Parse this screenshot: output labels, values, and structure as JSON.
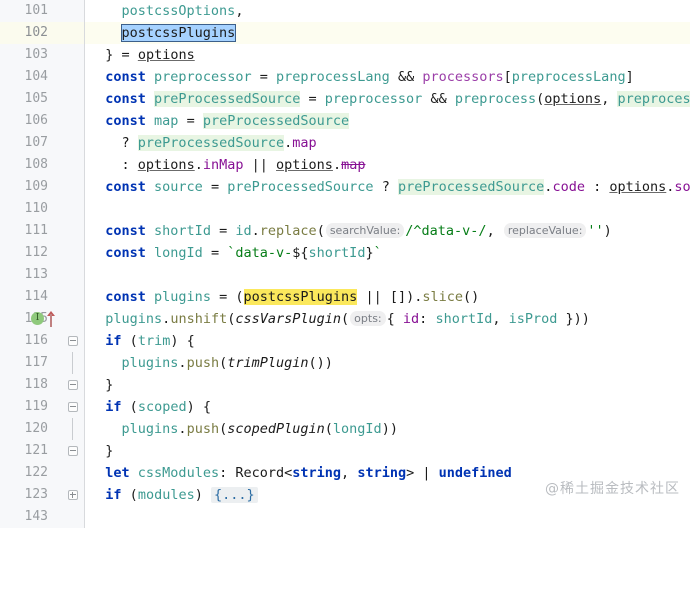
{
  "editor": {
    "language": "TypeScript",
    "first_visible_line": 101,
    "caret_line": 102,
    "selection_text": "postcssPlugins",
    "search_match_text": "postcssPlugins",
    "watermark": "@稀土掘金技术社区",
    "colors": {
      "background": "#ffffff",
      "gutter_background": "#f7f8fa",
      "line_number": "#999da1",
      "caret_row": "#fdfdf0",
      "keyword": "#0033b3",
      "identifier": "#3d9a91",
      "property": "#871094",
      "string": "#067d17",
      "function": "#7a7c43",
      "module_const": "#9b3ea8",
      "selection": "#a6d2ff",
      "search_highlight": "#fbe85c",
      "usage_highlight": "#e8f5e3",
      "inlay_hint_background": "#efeff0",
      "inlay_hint_text": "#7a7e85",
      "fold_placeholder_background": "#eceff1"
    }
  },
  "lines": [
    {
      "num": "101",
      "text": "    postcssOptions,"
    },
    {
      "num": "102",
      "text": "    postcssPlugins"
    },
    {
      "num": "103",
      "text": "  } = options"
    },
    {
      "num": "104",
      "text": "  const preprocessor = preprocessLang && processors[preprocessLang]"
    },
    {
      "num": "105",
      "text": "  const preProcessedSource = preprocessor && preprocess(options, preprocessor)"
    },
    {
      "num": "106",
      "text": "  const map = preProcessedSource"
    },
    {
      "num": "107",
      "text": "    ? preProcessedSource.map"
    },
    {
      "num": "108",
      "text": "    : options.inMap || options.map"
    },
    {
      "num": "109",
      "text": "  const source = preProcessedSource ? preProcessedSource.code : options.source"
    },
    {
      "num": "110",
      "text": ""
    },
    {
      "num": "111",
      "text": "  const shortId = id.replace( searchValue: /^data-v-/,  replaceValue: '')"
    },
    {
      "num": "112",
      "text": "  const longId = `data-v-${shortId}`"
    },
    {
      "num": "113",
      "text": ""
    },
    {
      "num": "114",
      "text": "  const plugins = (postcssPlugins || []).slice()"
    },
    {
      "num": "115",
      "text": "  plugins.unshift(cssVarsPlugin( opts: { id: shortId, isProd }))"
    },
    {
      "num": "116",
      "text": "  if (trim) {"
    },
    {
      "num": "117",
      "text": "    plugins.push(trimPlugin())"
    },
    {
      "num": "118",
      "text": "  }"
    },
    {
      "num": "119",
      "text": "  if (scoped) {"
    },
    {
      "num": "120",
      "text": "    plugins.push(scopedPlugin(longId))"
    },
    {
      "num": "121",
      "text": "  }"
    },
    {
      "num": "122",
      "text": "  let cssModules: Record<string, string> | undefined"
    },
    {
      "num": "123",
      "text": "  if (modules) {...}"
    },
    {
      "num": "143",
      "text": ""
    }
  ],
  "inlay_hints": [
    {
      "line": "111",
      "labels": [
        "searchValue:",
        "replaceValue:"
      ]
    },
    {
      "line": "115",
      "labels": [
        "opts:"
      ]
    }
  ],
  "gutter_icons": {
    "line_115": {
      "implementation_marker": "I",
      "arrow": "up-arrow-icon"
    }
  },
  "fold_markers": [
    {
      "line": "116",
      "state": "expanded"
    },
    {
      "line": "118",
      "state": "expanded-end"
    },
    {
      "line": "119",
      "state": "expanded"
    },
    {
      "line": "121",
      "state": "expanded-end"
    },
    {
      "line": "123",
      "state": "collapsed",
      "placeholder": "{...}"
    }
  ],
  "tokens": {
    "l101": {
      "a": "postcssOptions",
      "b": ","
    },
    "l102": {
      "a": "postcssPlugins"
    },
    "l103": {
      "a": "}",
      "b": "=",
      "c": "options"
    },
    "l104": {
      "kw": "const",
      "name": "preprocessor",
      "eq": "=",
      "r1": "preprocessLang",
      "op": "&&",
      "r2": "processors",
      "lb": "[",
      "r3": "preprocessLang",
      "rb": "]"
    },
    "l105": {
      "kw": "const",
      "name": "preProcessedSource",
      "eq": "=",
      "r1": "preprocessor",
      "op": "&&",
      "fn": "preprocess",
      "lp": "(",
      "a1": "options",
      "comma": ",",
      "a2": "preprocessor",
      "rp": ")"
    },
    "l106": {
      "kw": "const",
      "name": "map",
      "eq": "=",
      "r1": "preProcessedSource"
    },
    "l107": {
      "q": "?",
      "obj": "preProcessedSource",
      "dot": ".",
      "prop": "map"
    },
    "l108": {
      "c": ":",
      "obj1": "options",
      "p1": "inMap",
      "or": "||",
      "obj2": "options",
      "p2": "map"
    },
    "l109": {
      "kw": "const",
      "name": "source",
      "eq": "=",
      "cond": "preProcessedSource",
      "q": "?",
      "obj": "preProcessedSource",
      "prop": "code",
      "c": ":",
      "obj2": "options",
      "prop2": "source"
    },
    "l111": {
      "kw": "const",
      "name": "shortId",
      "eq": "=",
      "obj": "id",
      "fn": "replace",
      "hint1": "searchValue:",
      "regex": "/^data-v-/",
      "comma": ",",
      "hint2": "replaceValue:",
      "str": "''"
    },
    "l112": {
      "kw": "const",
      "name": "longId",
      "eq": "=",
      "tpl": "`data-v-${shortId}`"
    },
    "l114": {
      "kw": "const",
      "name": "plugins",
      "eq": "=",
      "hl": "postcssPlugins",
      "or": "||",
      "arr": "[]",
      "fn": "slice"
    },
    "l115": {
      "obj": "plugins",
      "fn": "unshift",
      "plugin": "cssVarsPlugin",
      "hint": "opts:",
      "id": "id",
      "shortId": "shortId",
      "isProd": "isProd"
    },
    "l116": {
      "kw": "if",
      "cond": "trim"
    },
    "l117": {
      "obj": "plugins",
      "fn": "push",
      "plugin": "trimPlugin"
    },
    "l119": {
      "kw": "if",
      "cond": "scoped"
    },
    "l120": {
      "obj": "plugins",
      "fn": "push",
      "plugin": "scopedPlugin",
      "arg": "longId"
    },
    "l122": {
      "kw": "let",
      "name": "cssModules",
      "type": "Record",
      "t1": "string",
      "t2": "string",
      "t3": "undefined"
    },
    "l123": {
      "kw": "if",
      "cond": "modules",
      "fold": "{...}"
    }
  }
}
